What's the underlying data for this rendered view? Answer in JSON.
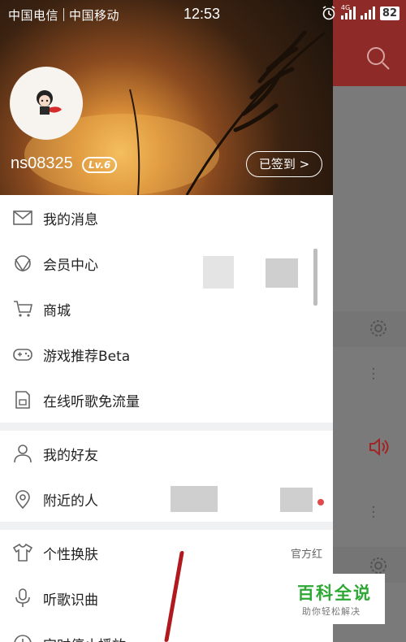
{
  "status_bar": {
    "carrier1": "中国电信",
    "carrier2": "中国移动",
    "time": "12:53",
    "network": "4G",
    "battery": "82"
  },
  "profile": {
    "username": "ns08325",
    "level": "Lv.6",
    "checkin_label": "已签到 >"
  },
  "menu": {
    "items": [
      {
        "label": "我的消息",
        "icon": "mail-icon"
      },
      {
        "label": "会员中心",
        "icon": "diamond-icon"
      },
      {
        "label": "商城",
        "icon": "cart-icon"
      },
      {
        "label": "游戏推荐Beta",
        "icon": "gamepad-icon"
      },
      {
        "label": "在线听歌免流量",
        "icon": "sim-card-icon"
      },
      {
        "label": "我的好友",
        "icon": "person-icon"
      },
      {
        "label": "附近的人",
        "icon": "location-pin-icon"
      },
      {
        "label": "个性换肤",
        "icon": "tshirt-icon",
        "value": "官方红"
      },
      {
        "label": "听歌识曲",
        "icon": "microphone-icon"
      },
      {
        "label": "定时停止播放",
        "icon": "clock-icon"
      }
    ]
  },
  "watermark": {
    "title": "百科全说",
    "subtitle": "助你轻松解决"
  },
  "colors": {
    "accent_red": "#c62f2f",
    "header_dark": "#3b2211",
    "watermark_green": "#2ea835"
  }
}
